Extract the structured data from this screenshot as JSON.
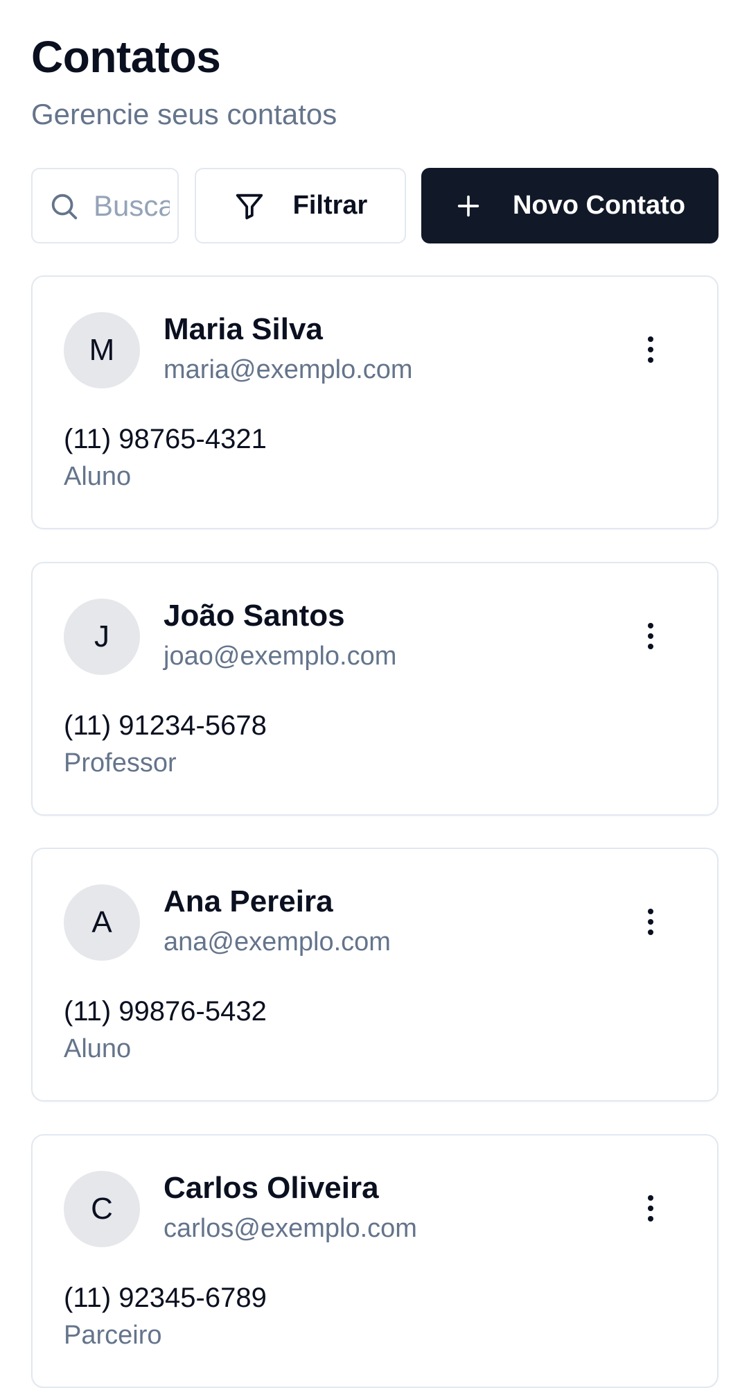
{
  "header": {
    "title": "Contatos",
    "subtitle": "Gerencie seus contatos"
  },
  "toolbar": {
    "search_placeholder": "Buscar",
    "search_value": "",
    "filter_label": "Filtrar",
    "new_contact_label": "Novo Contato"
  },
  "contacts": [
    {
      "initial": "M",
      "name": "Maria Silva",
      "email": "maria@exemplo.com",
      "phone": "(11) 98765-4321",
      "role": "Aluno"
    },
    {
      "initial": "J",
      "name": "João Santos",
      "email": "joao@exemplo.com",
      "phone": "(11) 91234-5678",
      "role": "Professor"
    },
    {
      "initial": "A",
      "name": "Ana Pereira",
      "email": "ana@exemplo.com",
      "phone": "(11) 99876-5432",
      "role": "Aluno"
    },
    {
      "initial": "C",
      "name": "Carlos Oliveira",
      "email": "carlos@exemplo.com",
      "phone": "(11) 92345-6789",
      "role": "Parceiro"
    }
  ],
  "icons": {
    "search": "search-icon",
    "filter": "filter-icon",
    "add": "plus-icon",
    "menu": "more-vertical-icon"
  },
  "colors": {
    "primary_button": "#111827",
    "muted_text": "#64748b",
    "border": "#e2e8f0",
    "avatar_bg": "#e5e7eb"
  }
}
